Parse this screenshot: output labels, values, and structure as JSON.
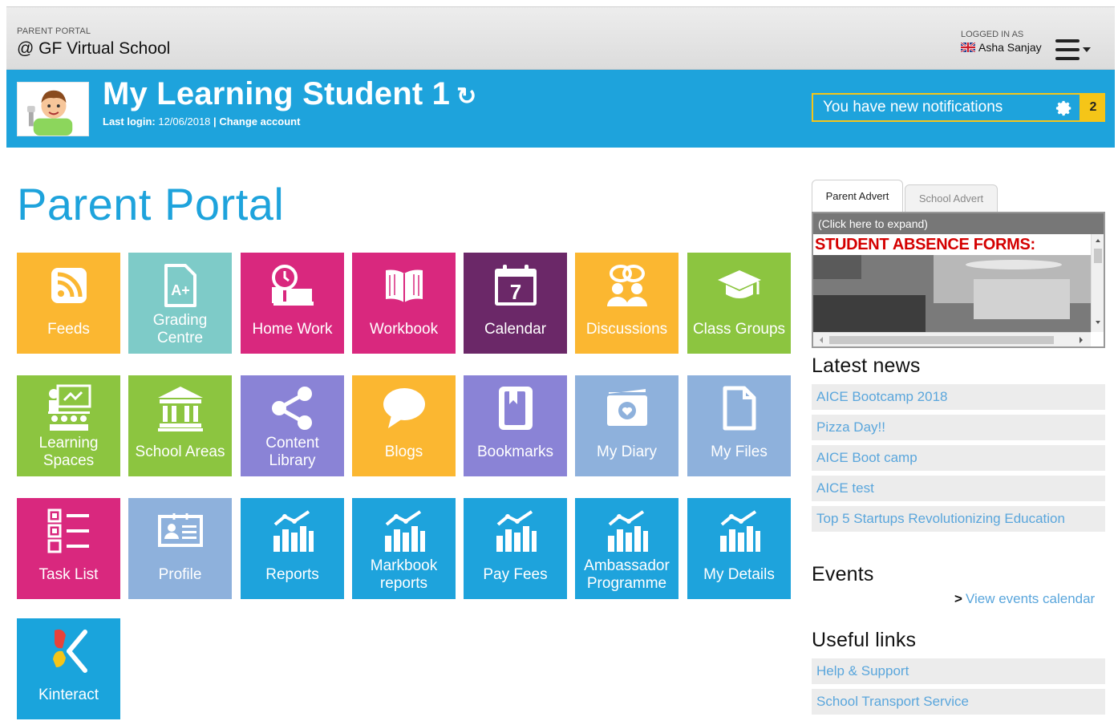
{
  "topbar": {
    "portal_label": "PARENT PORTAL",
    "school_name": "@ GF Virtual School",
    "logged_in_label": "LOGGED IN AS",
    "user_name": "Asha Sanjay"
  },
  "banner": {
    "student_name": "My Learning Student 1",
    "refresh_icon": "↻",
    "last_login_label": "Last login:",
    "last_login_date": "12/06/2018",
    "separator": "|",
    "change_account": "Change account",
    "notification_text": "You have new notifications",
    "notification_count": "2"
  },
  "page_title": "Parent Portal",
  "tiles": [
    {
      "label": "Feeds",
      "icon": "rss-icon",
      "color": "#fbb731"
    },
    {
      "label": "Grading Centre",
      "icon": "grade-file-icon",
      "color": "#7ecbc8"
    },
    {
      "label": "Home Work",
      "icon": "homework-icon",
      "color": "#d9287e"
    },
    {
      "label": "Workbook",
      "icon": "book-icon",
      "color": "#d9287e"
    },
    {
      "label": "Calendar",
      "icon": "calendar-icon",
      "color": "#6b2868"
    },
    {
      "label": "Discussions",
      "icon": "discussions-icon",
      "color": "#fbb731"
    },
    {
      "label": "Class Groups",
      "icon": "graduation-cap-icon",
      "color": "#8cc540"
    },
    {
      "label": "Learning Spaces",
      "icon": "classroom-icon",
      "color": "#8cc540"
    },
    {
      "label": "School Areas",
      "icon": "building-icon",
      "color": "#8cc540"
    },
    {
      "label": "Content Library",
      "icon": "share-icon",
      "color": "#8a83d6"
    },
    {
      "label": "Blogs",
      "icon": "speech-bubble-icon",
      "color": "#fbb731"
    },
    {
      "label": "Bookmarks",
      "icon": "bookmark-icon",
      "color": "#8a83d6"
    },
    {
      "label": "My Diary",
      "icon": "diary-icon",
      "color": "#8eb1dc"
    },
    {
      "label": "My Files",
      "icon": "file-icon",
      "color": "#8eb1dc"
    },
    {
      "label": "Task List",
      "icon": "task-list-icon",
      "color": "#d9287e"
    },
    {
      "label": "Profile",
      "icon": "id-card-icon",
      "color": "#8eb1dc"
    },
    {
      "label": "Reports",
      "icon": "bar-chart-icon",
      "color": "#1ea3dc"
    },
    {
      "label": "Markbook reports",
      "icon": "bar-chart-icon",
      "color": "#1ea3dc"
    },
    {
      "label": "Pay Fees",
      "icon": "bar-chart-icon",
      "color": "#1ea3dc"
    },
    {
      "label": "Ambassador Programme",
      "icon": "bar-chart-icon",
      "color": "#1ea3dc"
    },
    {
      "label": "My Details",
      "icon": "bar-chart-icon",
      "color": "#1ea3dc"
    },
    {
      "label": "Kinteract",
      "icon": "kinteract-logo-icon",
      "color": "#1aa4dc"
    }
  ],
  "advert": {
    "tab_parent": "Parent Advert",
    "tab_school": "School Advert",
    "expand_text": "(Click here to expand)",
    "headline": "STUDENT ABSENCE FORMS:"
  },
  "latest_news": {
    "heading": "Latest news",
    "items": [
      "AICE Bootcamp 2018",
      "Pizza Day!!",
      "AICE Boot camp",
      "AICE test",
      "Top 5 Startups Revolutionizing Education"
    ]
  },
  "events": {
    "heading": "Events",
    "view_calendar": "View events calendar"
  },
  "useful_links": {
    "heading": "Useful links",
    "items": [
      "Help & Support",
      "School Transport Service"
    ]
  }
}
